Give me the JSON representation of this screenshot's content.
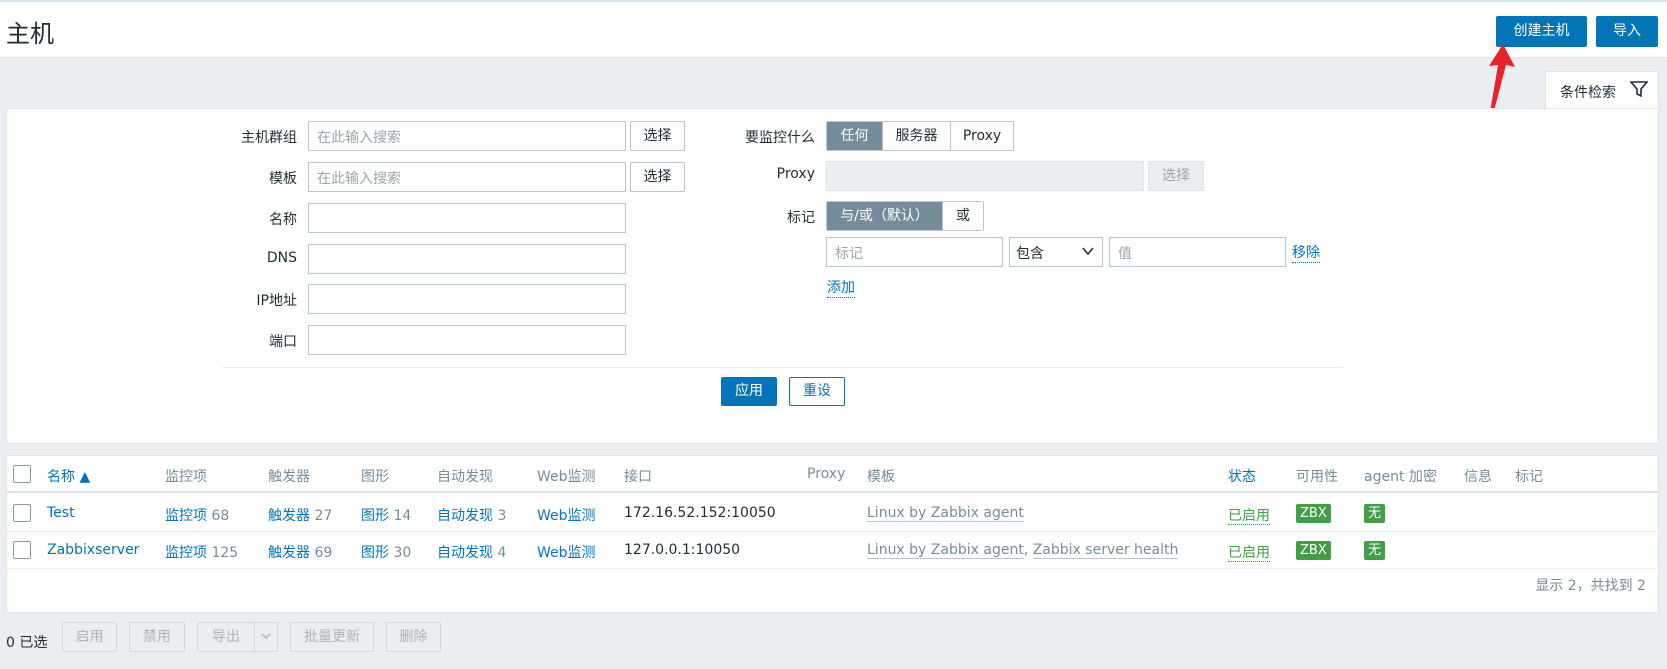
{
  "header": {
    "title": "主机",
    "create_host": "创建主机",
    "import": "导入"
  },
  "filter_tab": {
    "label": "条件检索",
    "icon": "filter-icon"
  },
  "filter": {
    "host_groups_label": "主机群组",
    "host_groups_placeholder": "在此输入搜索",
    "templates_label": "模板",
    "templates_placeholder": "在此输入搜索",
    "name_label": "名称",
    "dns_label": "DNS",
    "ip_label": "IP地址",
    "port_label": "端口",
    "select": "选择",
    "monitored_by_label": "要监控什么",
    "monitored_by_options": [
      "任何",
      "服务器",
      "Proxy"
    ],
    "monitored_by_selected": "任何",
    "proxy_label": "Proxy",
    "proxy_select": "选择",
    "tags_label": "标记",
    "tags_mode_options": [
      "与/或（默认）",
      "或"
    ],
    "tags_mode_selected": "与/或（默认）",
    "tag_placeholder": "标记",
    "tag_operator": "包含",
    "tag_value_placeholder": "值",
    "remove": "移除",
    "add": "添加",
    "apply": "应用",
    "reset": "重设"
  },
  "table": {
    "columns": [
      "名称 ▲",
      "监控项",
      "触发器",
      "图形",
      "自动发现",
      "Web监测",
      "接口",
      "Proxy",
      "模板",
      "状态",
      "可用性",
      "agent 加密",
      "信息",
      "标记"
    ],
    "rows": [
      {
        "name": "Test",
        "items_label": "监控项",
        "items_count": "68",
        "triggers_label": "触发器",
        "triggers_count": "27",
        "graphs_label": "图形",
        "graphs_count": "14",
        "discovery_label": "自动发现",
        "discovery_count": "3",
        "web": "Web监测",
        "interface": "172.16.52.152:10050",
        "proxy": "",
        "templates": [
          "Linux by Zabbix agent"
        ],
        "status": "已启用",
        "availability": "ZBX",
        "encryption": "无"
      },
      {
        "name": "Zabbixserver",
        "items_label": "监控项",
        "items_count": "125",
        "triggers_label": "触发器",
        "triggers_count": "69",
        "graphs_label": "图形",
        "graphs_count": "30",
        "discovery_label": "自动发现",
        "discovery_count": "4",
        "web": "Web监测",
        "interface": "127.0.0.1:10050",
        "proxy": "",
        "templates": [
          "Linux by Zabbix agent",
          "Zabbix server health"
        ],
        "status": "已启用",
        "availability": "ZBX",
        "encryption": "无"
      }
    ],
    "template_separator": ",",
    "footer": "显示 2，共找到 2"
  },
  "bulk": {
    "selected": "0 已选",
    "enable": "启用",
    "disable": "禁用",
    "export": "导出",
    "mass_update": "批量更新",
    "delete": "删除"
  },
  "colors": {
    "primary": "#0275b8",
    "enabled": "#429e47",
    "zbx_badge": "#59db8f",
    "annotation_arrow": "#e8242b"
  }
}
